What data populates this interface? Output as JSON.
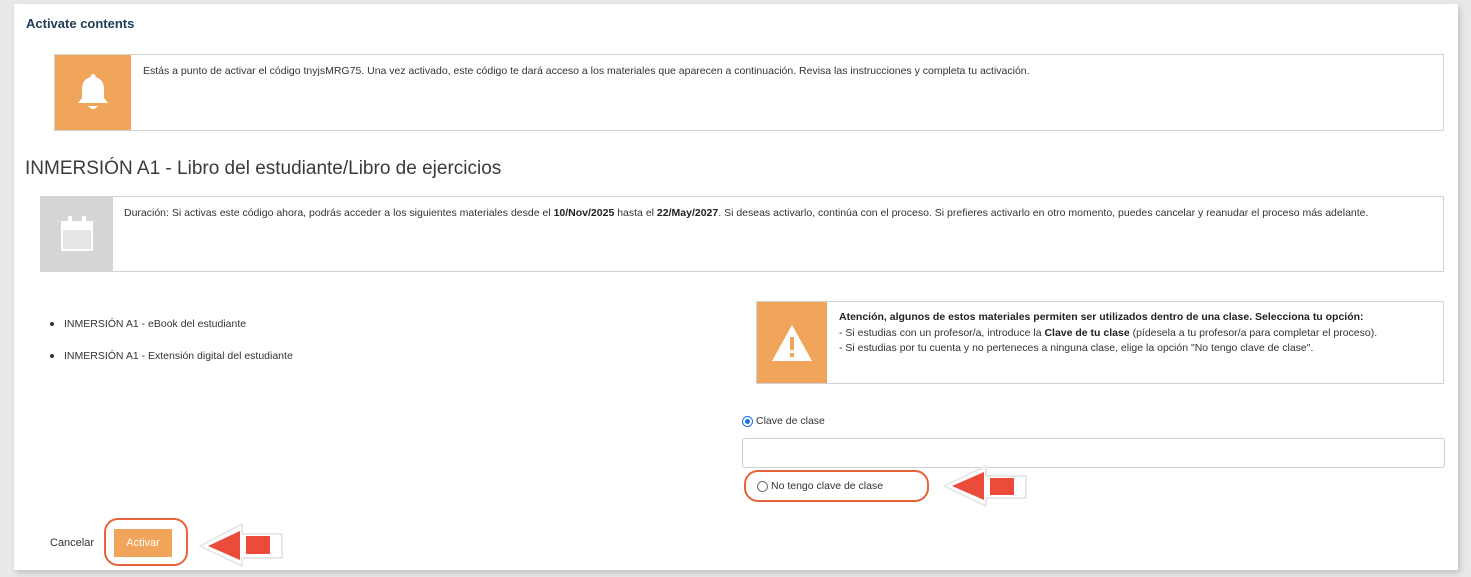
{
  "header": {
    "section_title": "Activate contents"
  },
  "notice": {
    "icon": "bell-icon",
    "text_before": "Estás a punto de activar el código ",
    "code": "tnyjsMRG75",
    "text_after": ". Una vez activado, este código te dará acceso a los materiales que aparecen a continuación. Revisa las instrucciones y completa tu activación."
  },
  "product": {
    "title": "INMERSIÓN A1 - Libro del estudiante/Libro de ejercicios"
  },
  "duration": {
    "icon": "calendar-icon",
    "text_1": "Duración: Si activas este código ahora, podrás acceder a los siguientes materiales desde el ",
    "start_date": "10/Nov/2025",
    "text_2": " hasta el ",
    "end_date": "22/May/2027",
    "text_3": ". Si deseas activarlo, continúa con el proceso. Si prefieres activarlo en otro momento, puedes cancelar y reanudar el proceso más adelante."
  },
  "materials": [
    {
      "label": "INMERSIÓN A1 - eBook del estudiante"
    },
    {
      "label": "INMERSIÓN A1 - Extensión digital del estudiante"
    }
  ],
  "warning": {
    "icon": "warning-icon",
    "heading": "Atención, algunos de estos materiales permiten ser utilizados dentro de una clase. Selecciona tu opción:",
    "line1_before": "- Si estudias con un profesor/a, introduce la ",
    "line1_bold": "Clave de tu clase",
    "line1_after": " (pídesela a tu profesor/a para completar el proceso).",
    "line2": "- Si estudias por tu cuenta y no perteneces a ninguna clase, elige la opción \"No tengo clave de clase\"."
  },
  "class_options": {
    "with_key_label": "Clave de clase",
    "with_key_selected": true,
    "key_value": "",
    "key_placeholder": "",
    "no_key_label": "No tengo clave de clase",
    "no_key_selected": false
  },
  "actions": {
    "cancel_label": "Cancelar",
    "activate_label": "Activar"
  },
  "colors": {
    "accent_orange": "#f0a55a",
    "icon_gray": "#d6d6d6",
    "highlight_red": "#e8623a",
    "radio_blue": "#1a73e8",
    "title_navy": "#1f3b57"
  }
}
